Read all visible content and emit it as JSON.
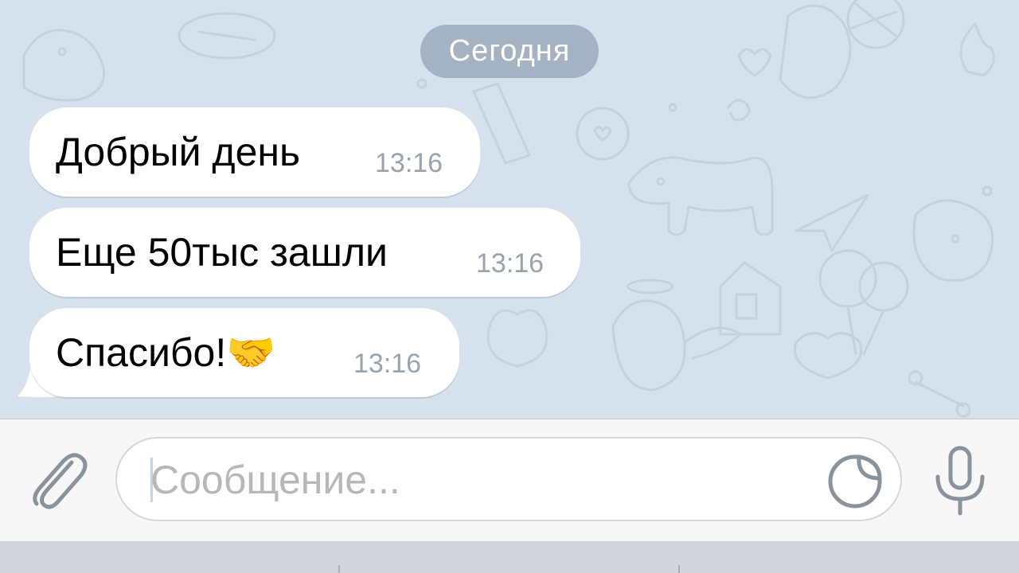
{
  "chat": {
    "date_label": "Сегодня",
    "messages": [
      {
        "text": "Добрый день",
        "time": "13:16"
      },
      {
        "text": "Еще 50тыс зашли",
        "time": "13:16"
      },
      {
        "text": "Спасибо!🤝",
        "time": "13:16"
      }
    ]
  },
  "composer": {
    "placeholder": "Сообщение...",
    "attach_icon": "paperclip-icon",
    "sticker_icon": "sticker-icon",
    "mic_icon": "microphone-icon"
  },
  "colors": {
    "chat_background": "#d5e1ed",
    "bubble": "#ffffff",
    "date_pill": "#a3b3c4",
    "icon_gray": "#8a939c",
    "time_text": "#9aa3ac"
  }
}
